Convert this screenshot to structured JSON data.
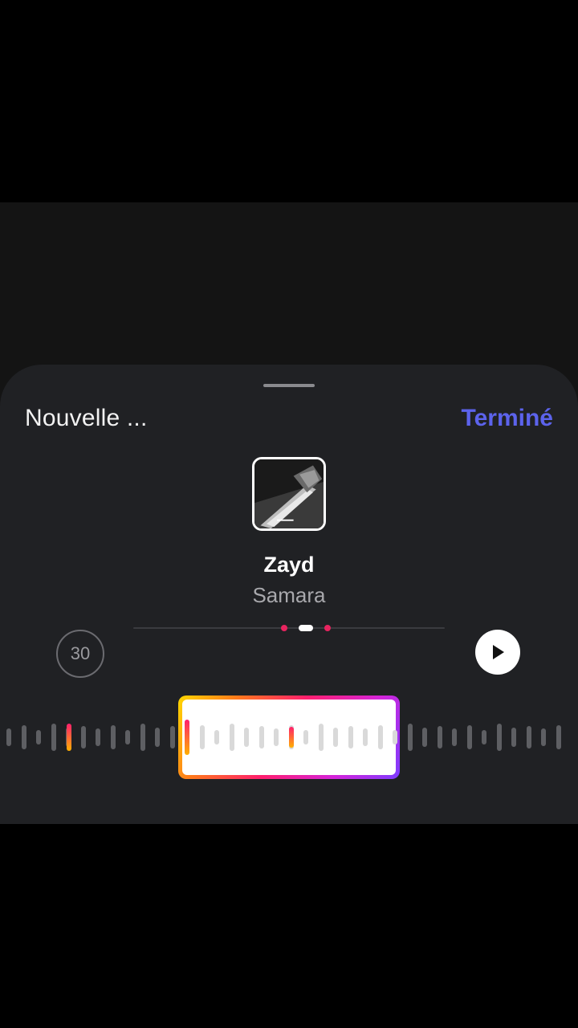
{
  "sheet": {
    "title": "Nouvelle ...",
    "done_label": "Terminé"
  },
  "track": {
    "cover_icon": "album-cover-image",
    "title": "Zayd",
    "artist": "Samara"
  },
  "player": {
    "duration_label": "30",
    "play_icon": "play-icon"
  },
  "colors": {
    "accent": "#5c63ec",
    "marker": "#e8245f",
    "sheet_background": "#202124"
  }
}
